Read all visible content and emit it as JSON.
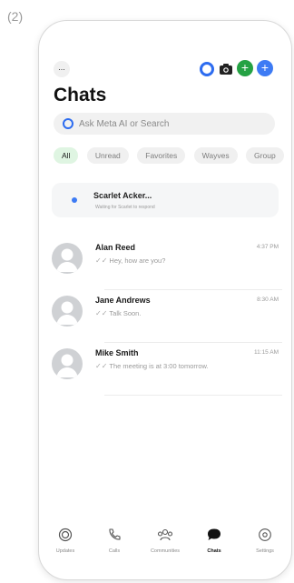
{
  "screenshot_label": "(2)",
  "header": {
    "title": "Chats",
    "more_label": "...",
    "new_chat_label": "+",
    "add_label": "+"
  },
  "search": {
    "placeholder": "Ask Meta AI or Search"
  },
  "filters": [
    "All",
    "Unread",
    "Favorites",
    "Wayves",
    "Group"
  ],
  "pinned": {
    "name": "Scarlet Acker...",
    "subtitle": "Waiting for Scarlet to respond"
  },
  "chats": [
    {
      "name": "Alan Reed",
      "time": "4:37 PM",
      "message": "Hey, how are you?"
    },
    {
      "name": "Jane Andrews",
      "time": "8:30 AM",
      "message": "Talk Soon."
    },
    {
      "name": "Mike Smith",
      "time": "11:15 AM",
      "message": "The meeting is at 3:00 tomorrow."
    }
  ],
  "tabs": [
    {
      "label": "Updates",
      "icon": "updates-icon"
    },
    {
      "label": "Calls",
      "icon": "phone-icon"
    },
    {
      "label": "Communities",
      "icon": "communities-icon"
    },
    {
      "label": "Chats",
      "icon": "chat-bubble-icon"
    },
    {
      "label": "Settings",
      "icon": "settings-icon"
    }
  ],
  "colors": {
    "accent_green": "#25a244",
    "accent_blue": "#3d7bf4",
    "chip_active": "#dff5e2"
  }
}
